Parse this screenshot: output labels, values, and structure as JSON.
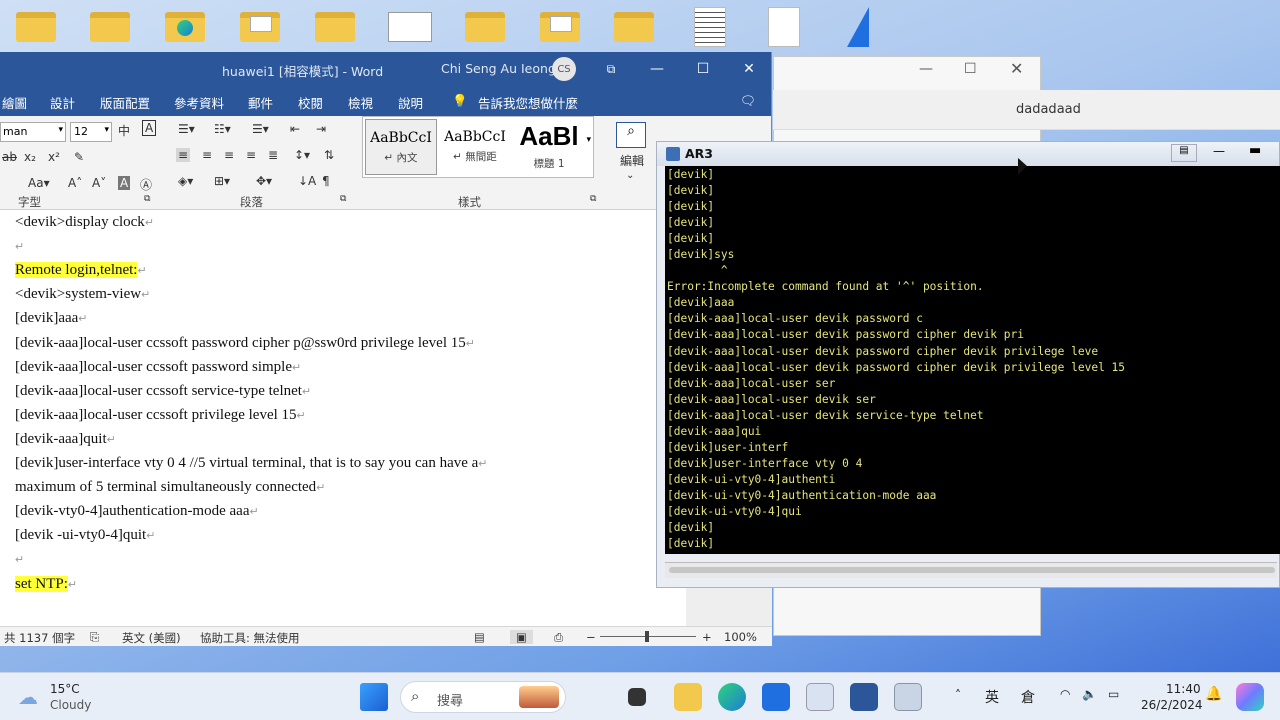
{
  "desktop": {
    "icons": [
      "folder-icon",
      "folder-icon",
      "folder-edge-icon",
      "folder-doc-icon",
      "folder-icon",
      "window-thumbnail-icon",
      "folder-icon",
      "folder-doc-icon",
      "folder-icon",
      "document-icon",
      "paper-icon",
      "shark-shortcut-icon"
    ]
  },
  "word": {
    "title": "huawei1 [相容模式]  -  Word",
    "user": "Chi Seng Au Ieong",
    "avatar": "CS",
    "menu": [
      "繪圖",
      "設計",
      "版面配置",
      "參考資料",
      "郵件",
      "校閱",
      "檢視",
      "說明",
      "告訴我您想做什麼"
    ],
    "font_name": "man",
    "font_size": "12",
    "styles": [
      {
        "preview": "AaBbCcI",
        "name": "↵ 內文"
      },
      {
        "preview": "AaBbCcI",
        "name": "↵ 無間距"
      },
      {
        "preview": "AaBl",
        "name": "標題 1"
      }
    ],
    "groups": {
      "font": "字型",
      "paragraph": "段落",
      "styles": "樣式",
      "edit": "編輯"
    },
    "doc_lines": [
      {
        "text": "<devik>display clock",
        "hl": false
      },
      {
        "text": "",
        "hl": false
      },
      {
        "text": "Remote login,telnet:",
        "hl": true
      },
      {
        "text": "<devik>system-view",
        "hl": false
      },
      {
        "text": "[devik]aaa",
        "hl": false
      },
      {
        "text": "[devik-aaa]local-user ccssoft password cipher p@ssw0rd privilege level 15",
        "hl": false
      },
      {
        "text": "[devik-aaa]local-user ccssoft password simple",
        "hl": false
      },
      {
        "text": "[devik-aaa]local-user ccssoft service-type telnet",
        "hl": false
      },
      {
        "text": "[devik-aaa]local-user ccssoft privilege level 15",
        "hl": false
      },
      {
        "text": "[devik-aaa]quit",
        "hl": false
      },
      {
        "text": "[devik]user-interface vty 0 4 //5 virtual terminal, that is to say you can have a",
        "hl": false
      },
      {
        "text": "maximum of 5 terminal simultaneously connected",
        "hl": false
      },
      {
        "text": "[devik-vty0-4]authentication-mode aaa",
        "hl": false
      },
      {
        "text": "[devik -ui-vty0-4]quit",
        "hl": false
      },
      {
        "text": "",
        "hl": false
      },
      {
        "text": "set NTP:",
        "hl": true
      }
    ],
    "status": {
      "words": "共 1137 個字",
      "lang": "英文 (美國)",
      "access": "協助工具: 無法使用",
      "zoom": "100%"
    }
  },
  "window2": {
    "title": "dadadaad"
  },
  "ar3": {
    "title": "AR3",
    "lines": [
      "[devik]",
      "[devik]",
      "[devik]",
      "[devik]",
      "[devik]",
      "[devik]sys",
      "        ^",
      "Error:Incomplete command found at '^' position.",
      "[devik]aaa",
      "[devik-aaa]local-user devik password c",
      "[devik-aaa]local-user devik password cipher devik pri",
      "[devik-aaa]local-user devik password cipher devik privilege leve",
      "[devik-aaa]local-user devik password cipher devik privilege level 15",
      "[devik-aaa]local-user ser",
      "[devik-aaa]local-user devik ser",
      "[devik-aaa]local-user devik service-type telnet",
      "[devik-aaa]qui",
      "[devik]user-interf",
      "[devik]user-interface vty 0 4",
      "[devik-ui-vty0-4]authenti",
      "[devik-ui-vty0-4]authentication-mode aaa",
      "[devik-ui-vty0-4]qui",
      "[devik]",
      "[devik]"
    ]
  },
  "taskbar": {
    "weather_temp": "15°C",
    "weather_desc": "Cloudy",
    "search_placeholder": "搜尋",
    "ime1": "英",
    "ime2": "倉",
    "time": "11:40",
    "date": "26/2/2024"
  }
}
